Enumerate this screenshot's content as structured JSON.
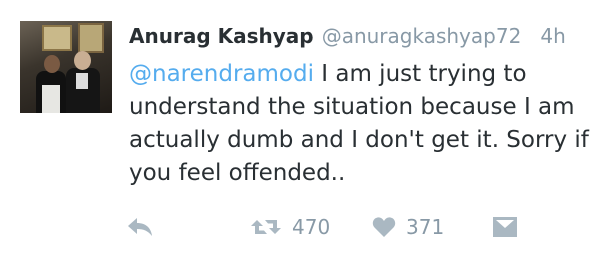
{
  "tweet": {
    "name": "Anurag Kashyap",
    "handle": "@anuragkashyap72",
    "time": "4h",
    "mention": "@narendramodi",
    "body": " I am just trying to understand the situation because I am actually dumb and I don't get it. Sorry if you feel offended..",
    "retweet_count": "470",
    "like_count": "371"
  },
  "colors": {
    "mention": "#55acee",
    "text": "#292f33",
    "muted": "#8899a6",
    "icon": "#aab8c2"
  },
  "icons": [
    "reply-icon",
    "retweet-icon",
    "heart-icon",
    "dm-icon"
  ]
}
